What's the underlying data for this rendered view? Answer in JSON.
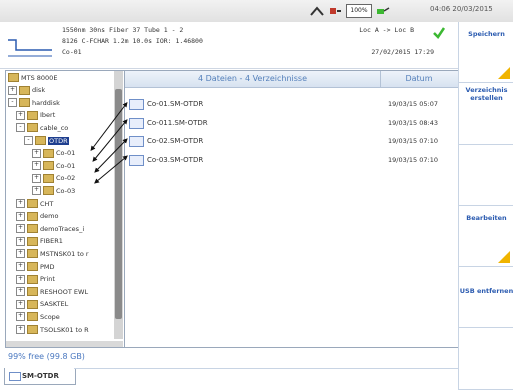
{
  "status": {
    "battery_percent": "100%",
    "datetime": "04:06 20/03/2015"
  },
  "trace_info": {
    "line1": "1550nm 30ns Fiber 37 Tube 1 - 2",
    "line2": "8126 C-FCHAR 1.2m 10.0s IOR: 1.46800",
    "line3": "Co-01",
    "loc": "Loc A -> Loc B",
    "date": "27/02/2015 17:29"
  },
  "tree": [
    {
      "label": "MTS 8000E",
      "level": 0,
      "expander": ""
    },
    {
      "label": "disk",
      "level": 0,
      "expander": "+"
    },
    {
      "label": "harddisk",
      "level": 0,
      "expander": "-"
    },
    {
      "label": "Ibert",
      "level": 1,
      "expander": "+"
    },
    {
      "label": "cable_co",
      "level": 1,
      "expander": "-"
    },
    {
      "label": "OTDR",
      "level": 2,
      "expander": "-",
      "selected": true
    },
    {
      "label": "Co-01",
      "level": 3,
      "expander": "+"
    },
    {
      "label": "Co-01",
      "level": 3,
      "expander": "+"
    },
    {
      "label": "Co-02",
      "level": 3,
      "expander": "+"
    },
    {
      "label": "Co-03",
      "level": 3,
      "expander": "+"
    },
    {
      "label": "CHT",
      "level": 1,
      "expander": "+"
    },
    {
      "label": "demo",
      "level": 1,
      "expander": "+"
    },
    {
      "label": "demoTraces_i",
      "level": 1,
      "expander": "+"
    },
    {
      "label": "FIBER1",
      "level": 1,
      "expander": "+"
    },
    {
      "label": "MSTNSK01 to r",
      "level": 1,
      "expander": "+"
    },
    {
      "label": "PMD",
      "level": 1,
      "expander": "+"
    },
    {
      "label": "Print",
      "level": 1,
      "expander": "+"
    },
    {
      "label": "RESHOOT EWL",
      "level": 1,
      "expander": "+"
    },
    {
      "label": "SASKTEL",
      "level": 1,
      "expander": "+"
    },
    {
      "label": "Scope",
      "level": 1,
      "expander": "+"
    },
    {
      "label": "TSOLSK01 to R",
      "level": 1,
      "expander": "+"
    }
  ],
  "free_space": "99% free (99.8 GB)",
  "file_list": {
    "header_name": "4 Dateien - 4 Verzeichnisse",
    "header_date": "Datum",
    "files": [
      {
        "name": "Co-01.SM-OTDR",
        "date": "19/03/15 05:07"
      },
      {
        "name": "Co-011.SM-OTDR",
        "date": "19/03/15 08:43"
      },
      {
        "name": "Co-02.SM-OTDR",
        "date": "19/03/15 07:10"
      },
      {
        "name": "Co-03.SM-OTDR",
        "date": "19/03/15 07:10"
      }
    ]
  },
  "soft_keys": [
    {
      "label": "Speichern",
      "icon": "triangle-icon"
    },
    {
      "label": "Verzeichnis erstellen",
      "icon": ""
    },
    {
      "label": "",
      "icon": ""
    },
    {
      "label": "Bearbeiten",
      "icon": "triangle-icon"
    },
    {
      "label": "USB entfernen",
      "icon": ""
    },
    {
      "label": "",
      "icon": ""
    }
  ],
  "bottom_tab": "SM-OTDR",
  "colors": {
    "accent": "#2b5bb0",
    "selected": "#1f3f8f",
    "folder": "#d7b65a",
    "check": "#3cb832",
    "soft_key_triangle": "#f0b400"
  }
}
